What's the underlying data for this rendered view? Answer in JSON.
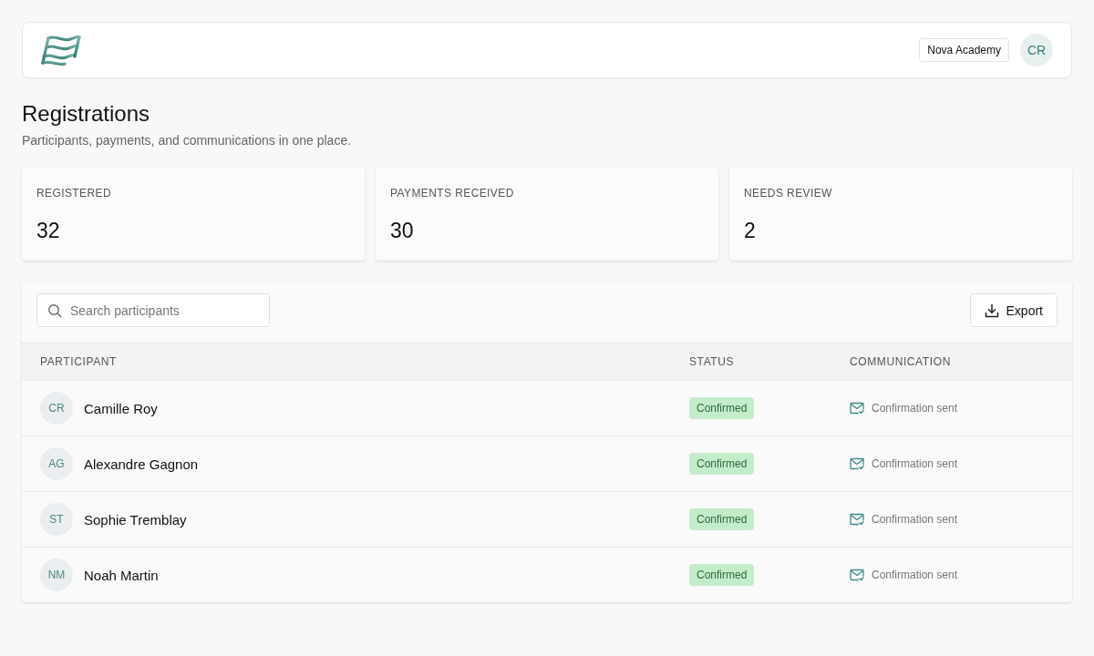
{
  "header": {
    "organization": "Nova Academy",
    "user_initials": "CR"
  },
  "page": {
    "title": "Registrations",
    "subtitle": "Participants, payments, and communications in one place."
  },
  "stats": [
    {
      "label": "REGISTERED",
      "value": "32"
    },
    {
      "label": "PAYMENTS RECEIVED",
      "value": "30"
    },
    {
      "label": "NEEDS REVIEW",
      "value": "2"
    }
  ],
  "toolbar": {
    "search": {
      "placeholder": "Search participants"
    },
    "export_button": "Export"
  },
  "table": {
    "columns": [
      "PARTICIPANT",
      "STATUS",
      "COMMUNICATION"
    ],
    "rows": [
      {
        "initials": "CR",
        "name": "Camille Roy",
        "status": {
          "label": "Confirmed",
          "kind": "success"
        },
        "communication": "Confirmation sent"
      },
      {
        "initials": "AG",
        "name": "Alexandre Gagnon",
        "status": {
          "label": "Confirmed",
          "kind": "success"
        },
        "communication": "Confirmation sent"
      },
      {
        "initials": "ST",
        "name": "Sophie Tremblay",
        "status": {
          "label": "Confirmed",
          "kind": "success"
        },
        "communication": "Confirmation sent"
      },
      {
        "initials": "NM",
        "name": "Noah Martin",
        "status": {
          "label": "Confirmed",
          "kind": "success"
        },
        "communication": "Confirmation sent"
      }
    ]
  }
}
